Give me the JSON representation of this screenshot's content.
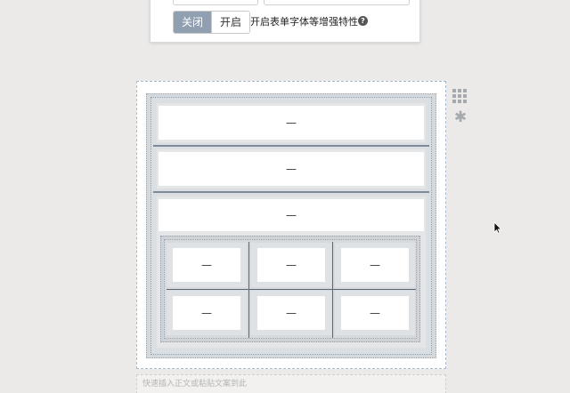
{
  "settings": {
    "toggle_off_label": "关闭",
    "toggle_on_label": "开启",
    "option_label": "开启表单字体等增强特性",
    "help_glyph": "?"
  },
  "editor": {
    "rows": [
      {
        "text": "—"
      },
      {
        "text": "—"
      },
      {
        "text": "—"
      }
    ],
    "grid": [
      [
        "—",
        "—",
        "—"
      ],
      [
        "—",
        "—",
        "—"
      ]
    ],
    "quick_insert_placeholder": "快速插入正文或粘贴文案到此"
  },
  "icons": {
    "grid": "grid-icon",
    "gear": "gear-icon",
    "help": "question-circle-icon",
    "cursor": "mouse-pointer-icon"
  },
  "colors": {
    "toggle_active": "#90a0b1",
    "canvas_border": "#a6bad2",
    "background": "#ebeae9"
  }
}
